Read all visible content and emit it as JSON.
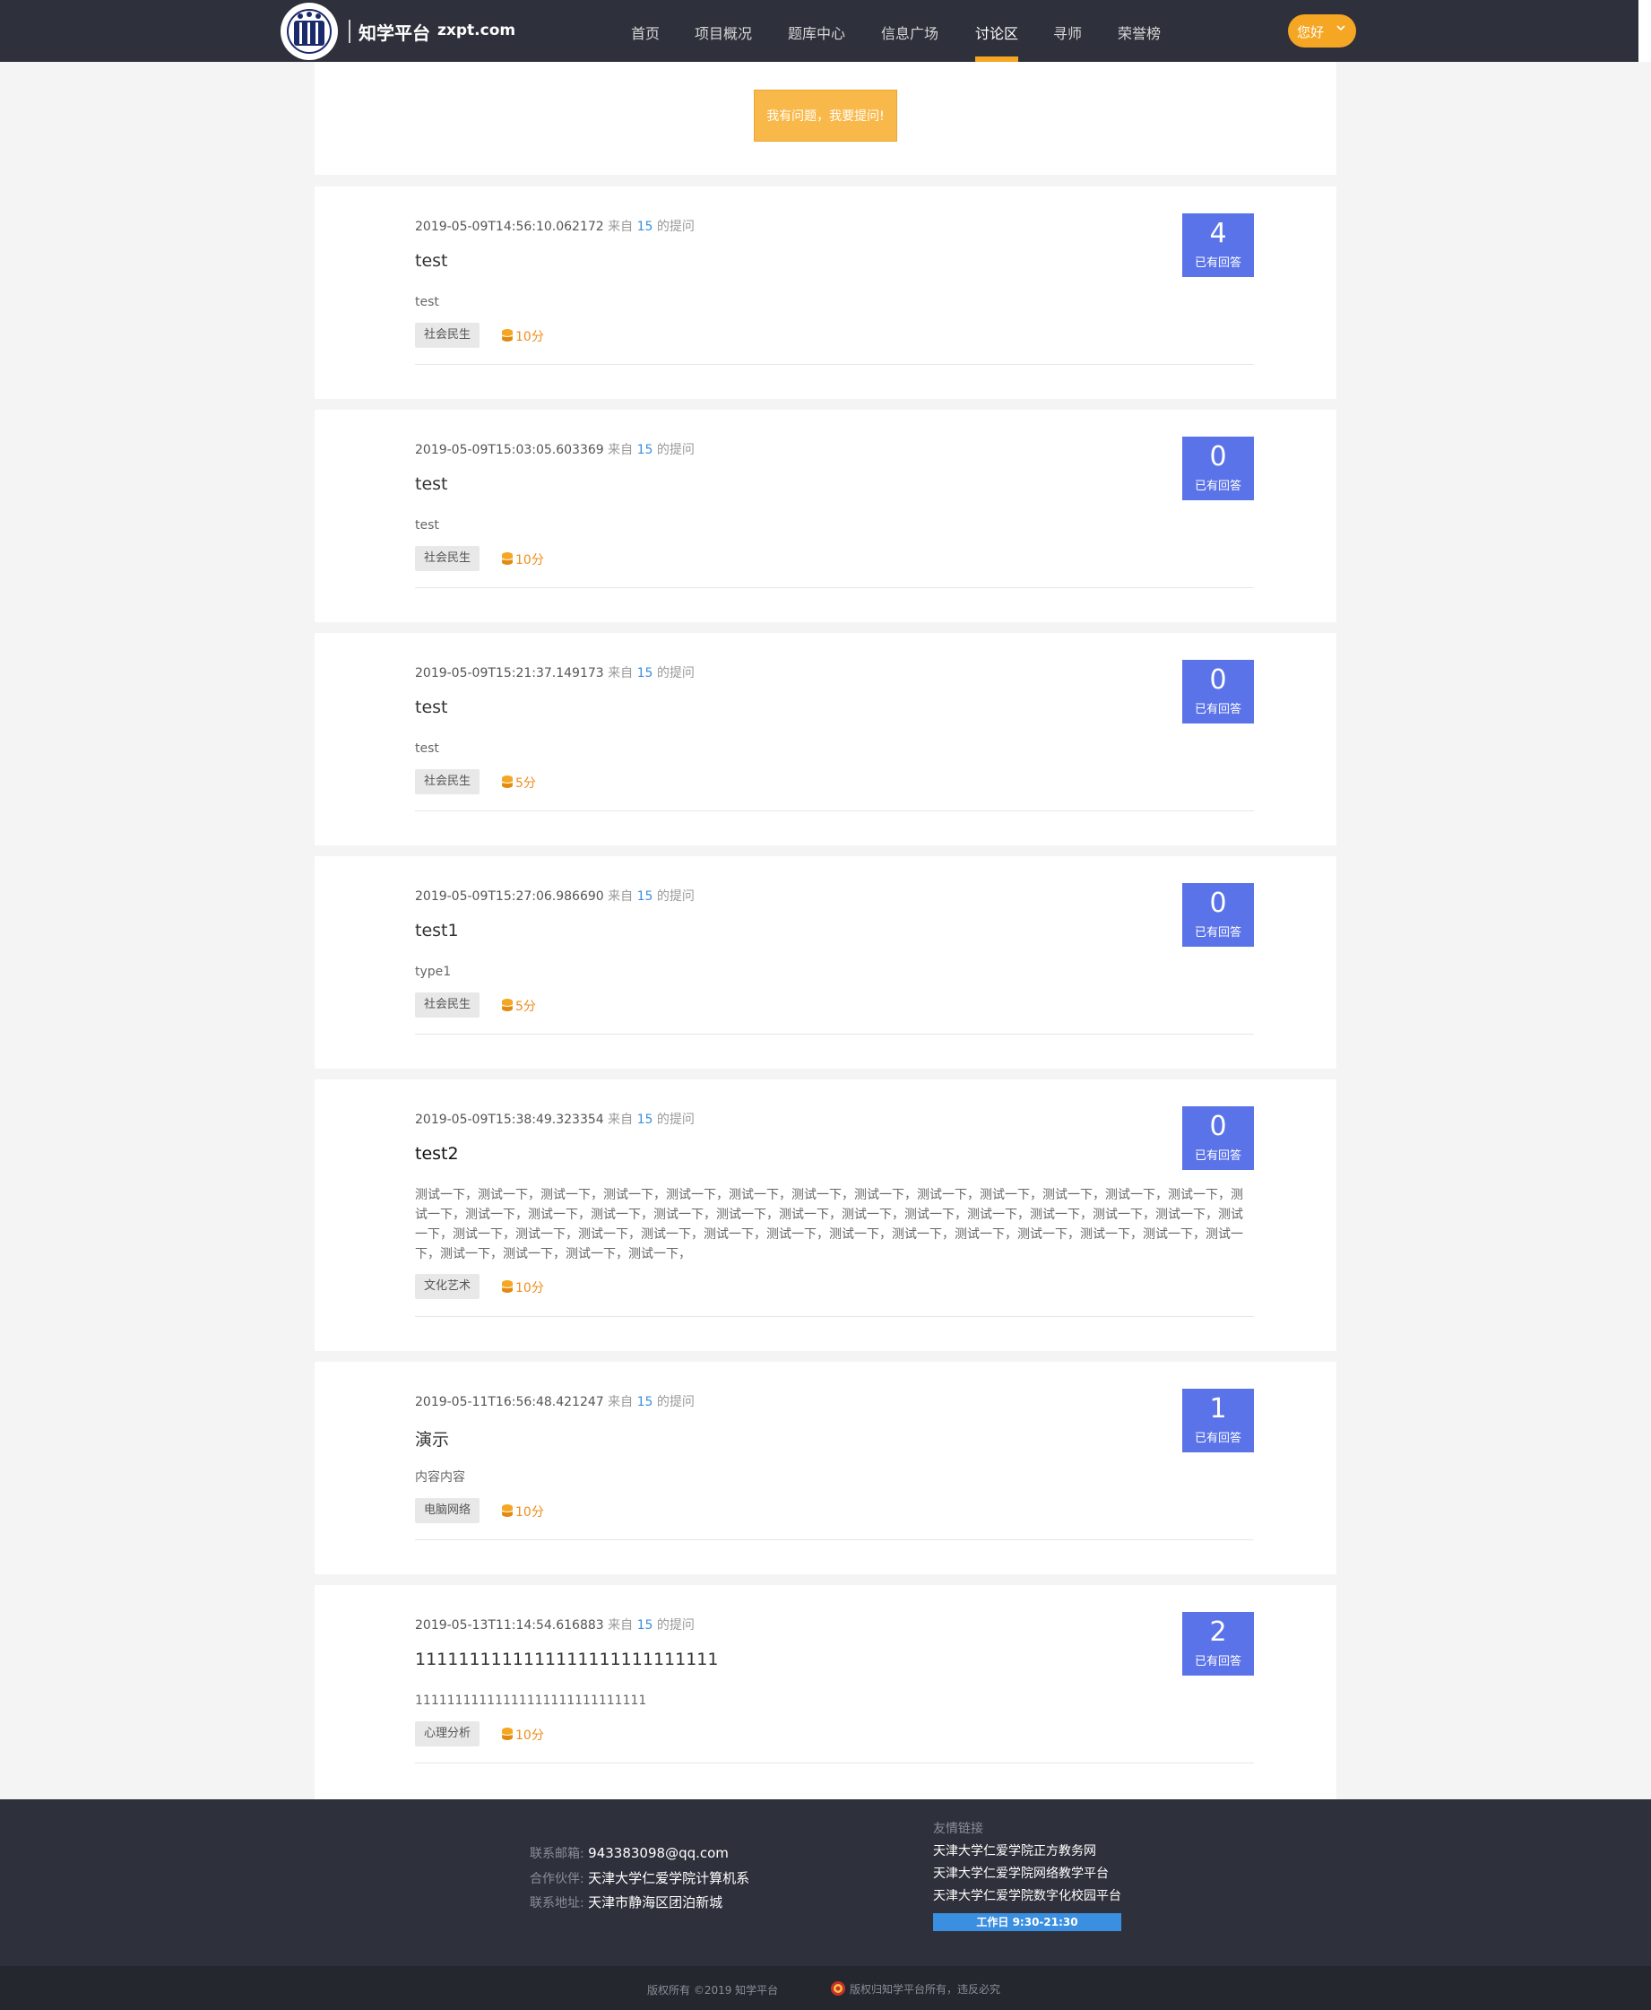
{
  "header": {
    "brand_name": "知学平台",
    "brand_domain": "zxpt.com",
    "nav": [
      "首页",
      "项目概况",
      "题库中心",
      "信息广场",
      "讨论区",
      "寻师",
      "荣誉榜"
    ],
    "active_nav": "讨论区",
    "user_button": "您好"
  },
  "ask_button": "我有问题，我要提问!",
  "questions": [
    {
      "time": "2019-05-09T14:56:10.062172",
      "from": "来自",
      "uid": "15",
      "suffix": "的提问",
      "title": "test",
      "body": "test",
      "tag": "社会民生",
      "points": "10分",
      "answers": "4",
      "answers_label": "已有回答"
    },
    {
      "time": "2019-05-09T15:03:05.603369",
      "from": "来自",
      "uid": "15",
      "suffix": "的提问",
      "title": "test",
      "body": "test",
      "tag": "社会民生",
      "points": "10分",
      "answers": "0",
      "answers_label": "已有回答"
    },
    {
      "time": "2019-05-09T15:21:37.149173",
      "from": "来自",
      "uid": "15",
      "suffix": "的提问",
      "title": "test",
      "body": "test",
      "tag": "社会民生",
      "points": "5分",
      "answers": "0",
      "answers_label": "已有回答"
    },
    {
      "time": "2019-05-09T15:27:06.986690",
      "from": "来自",
      "uid": "15",
      "suffix": "的提问",
      "title": "test1",
      "body": "type1",
      "tag": "社会民生",
      "points": "5分",
      "answers": "0",
      "answers_label": "已有回答"
    },
    {
      "time": "2019-05-09T15:38:49.323354",
      "from": "来自",
      "uid": "15",
      "suffix": "的提问",
      "title": "test2",
      "body": "测试一下，测试一下，测试一下，测试一下，测试一下，测试一下，测试一下，测试一下，测试一下，测试一下，测试一下，测试一下，测试一下，测试一下，测试一下，测试一下，测试一下，测试一下，测试一下，测试一下，测试一下，测试一下，测试一下，测试一下，测试一下，测试一下，测试一下，测试一下，测试一下，测试一下，测试一下，测试一下，测试一下，测试一下，测试一下，测试一下，测试一下，测试一下，测试一下，测试一下，测试一下，测试一下，测试一下，测试一下，",
      "tag": "文化艺术",
      "points": "10分",
      "answers": "0",
      "answers_label": "已有回答"
    },
    {
      "time": "2019-05-11T16:56:48.421247",
      "from": "来自",
      "uid": "15",
      "suffix": "的提问",
      "title": "演示",
      "body": "内容内容",
      "tag": "电脑网络",
      "points": "10分",
      "answers": "1",
      "answers_label": "已有回答"
    },
    {
      "time": "2019-05-13T11:14:54.616883",
      "from": "来自",
      "uid": "15",
      "suffix": "的提问",
      "title": "1111111111111111111111111111",
      "body": "11111111111111111111111111111",
      "tag": "心理分析",
      "points": "10分",
      "answers": "2",
      "answers_label": "已有回答"
    }
  ],
  "footer": {
    "email_label": "联系邮箱:",
    "email": "943383098@qq.com",
    "partner_label": "合作伙伴:",
    "partner": "天津大学仁爱学院计算机系",
    "address_label": "联系地址:",
    "address": "天津市静海区团泊新城",
    "links_title": "友情链接",
    "links": [
      "天津大学仁爱学院正方教务网",
      "天津大学仁爱学院网络教学平台",
      "天津大学仁爱学院数字化校园平台"
    ],
    "work_hours": "工作日 9:30-21:30",
    "copyright_left": "版权所有 ©2019 知学平台",
    "copyright_right": "版权归知学平台所有，违反必究"
  },
  "colors": {
    "header_bg": "#2e313b",
    "accent": "#f5a623",
    "answer_box": "#5b73e8",
    "link_blue": "#3b8fe0",
    "points_orange": "#f08c1a"
  }
}
